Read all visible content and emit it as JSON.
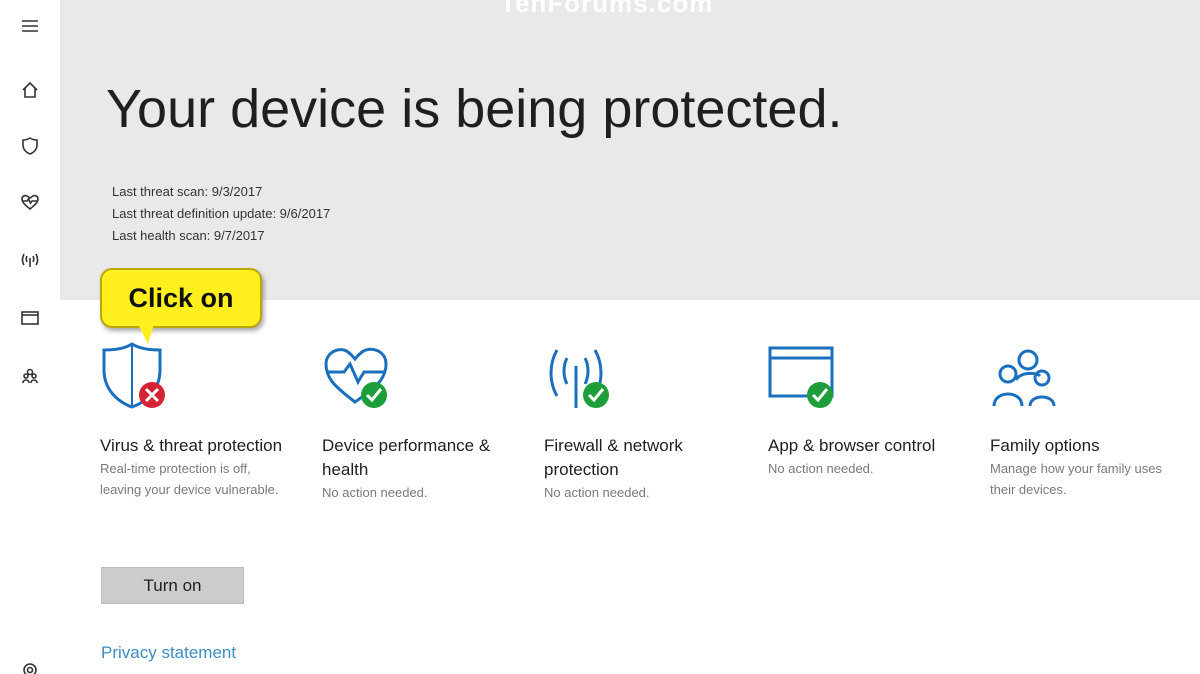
{
  "watermark": "TenForums.com",
  "hero": {
    "title": "Your device is being protected.",
    "last_threat_scan": "Last threat scan:  9/3/2017",
    "last_definition_update": "Last threat definition update:  9/6/2017",
    "last_health_scan": "Last health scan:  9/7/2017"
  },
  "callout": {
    "text": "Click on"
  },
  "tiles": [
    {
      "title": "Virus & threat protection",
      "desc": "Real-time protection is off, leaving your device vulnerable.",
      "status": "error",
      "icon": "shield-icon"
    },
    {
      "title": "Device performance & health",
      "desc": "No action needed.",
      "status": "ok",
      "icon": "heart-pulse-icon"
    },
    {
      "title": "Firewall & network protection",
      "desc": "No action needed.",
      "status": "ok",
      "icon": "antenna-icon"
    },
    {
      "title": "App & browser control",
      "desc": "No action needed.",
      "status": "ok",
      "icon": "browser-window-icon"
    },
    {
      "title": "Family options",
      "desc": "Manage how your family uses their devices.",
      "status": "none",
      "icon": "family-icon"
    }
  ],
  "actions": {
    "turn_on": "Turn on",
    "privacy": "Privacy statement"
  },
  "colors": {
    "accent": "#1a6fbf",
    "ok": "#1e9e3a",
    "error": "#d42335",
    "callout": "#ffef1f"
  }
}
